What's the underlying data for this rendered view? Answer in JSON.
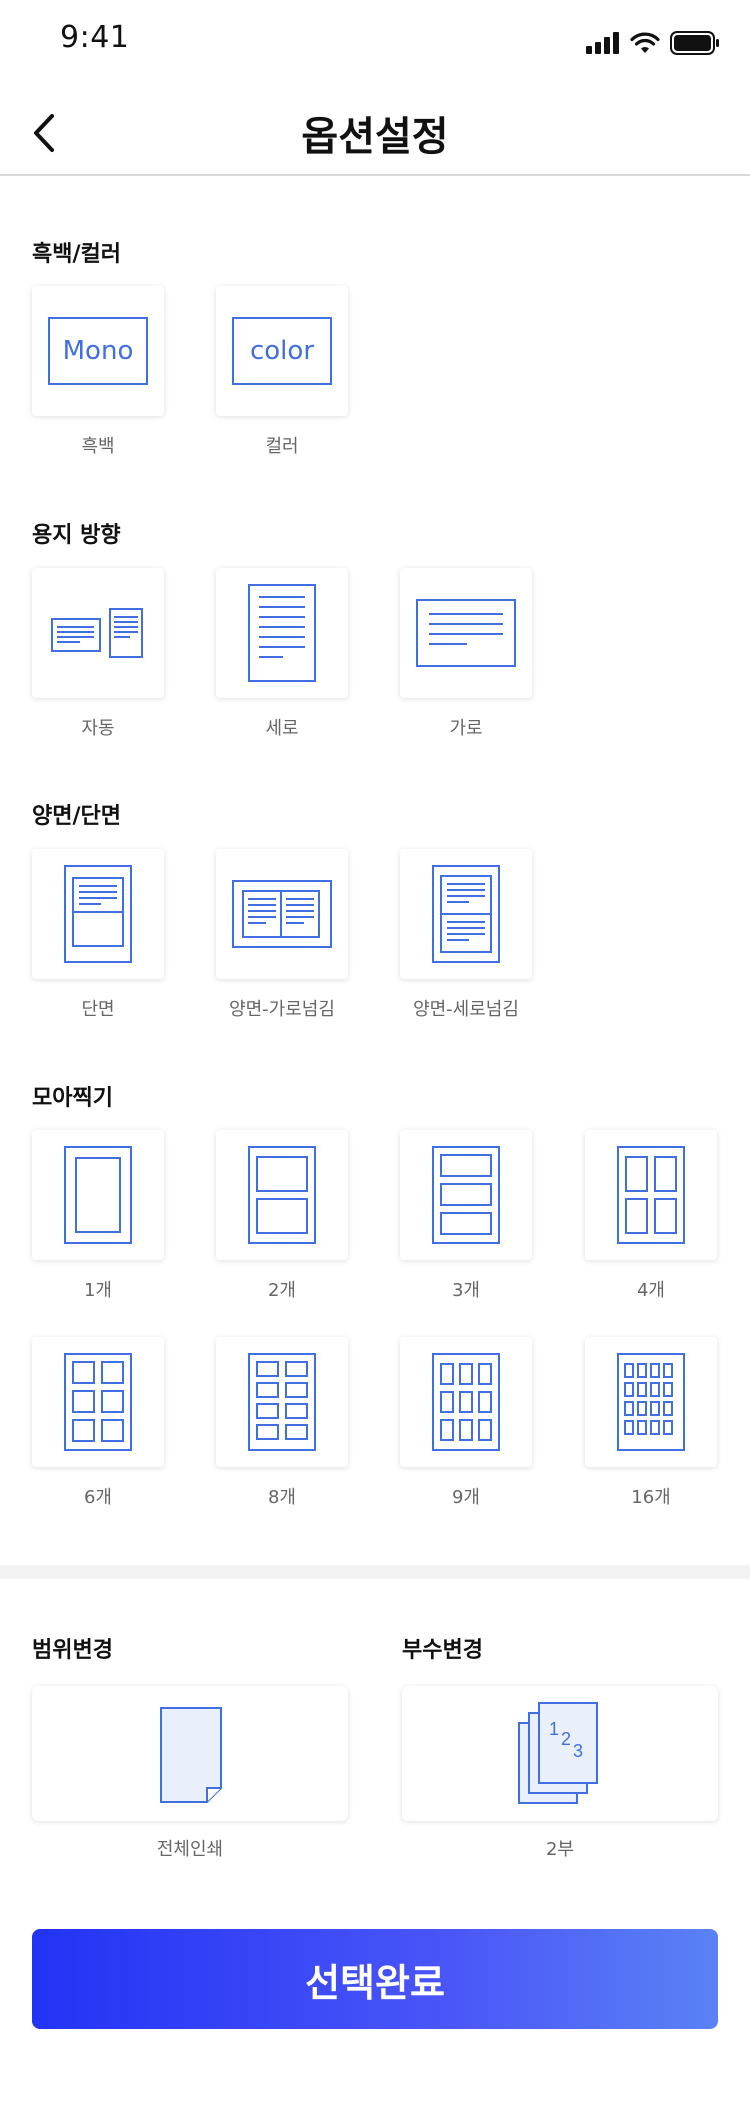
{
  "status_bar": {
    "time": "9:41"
  },
  "header": {
    "title": "옵션설정"
  },
  "sections": {
    "color": {
      "title": "흑백/컬러",
      "options": [
        {
          "icon_text": "Mono",
          "label": "흑백"
        },
        {
          "icon_text": "color",
          "label": "컬러"
        }
      ]
    },
    "orientation": {
      "title": "용지 방향",
      "options": [
        {
          "label": "자동"
        },
        {
          "label": "세로"
        },
        {
          "label": "가로"
        }
      ]
    },
    "duplex": {
      "title": "양면/단면",
      "options": [
        {
          "label": "단면"
        },
        {
          "label": "양면-가로넘김"
        },
        {
          "label": "양면-세로넘김"
        }
      ]
    },
    "nup": {
      "title": "모아찍기",
      "options": [
        {
          "label": "1개"
        },
        {
          "label": "2개"
        },
        {
          "label": "3개"
        },
        {
          "label": "4개"
        },
        {
          "label": "6개"
        },
        {
          "label": "8개"
        },
        {
          "label": "9개"
        },
        {
          "label": "16개"
        }
      ]
    },
    "range": {
      "title": "범위변경",
      "value": "전체인쇄"
    },
    "copies": {
      "title": "부수변경",
      "value": "2부",
      "icon_digits": [
        "1",
        "2",
        "3"
      ]
    }
  },
  "submit_label": "선택완료",
  "colors": {
    "accent": "#3f6fe0",
    "button_start": "#2233f5",
    "button_end": "#5a82f5"
  }
}
